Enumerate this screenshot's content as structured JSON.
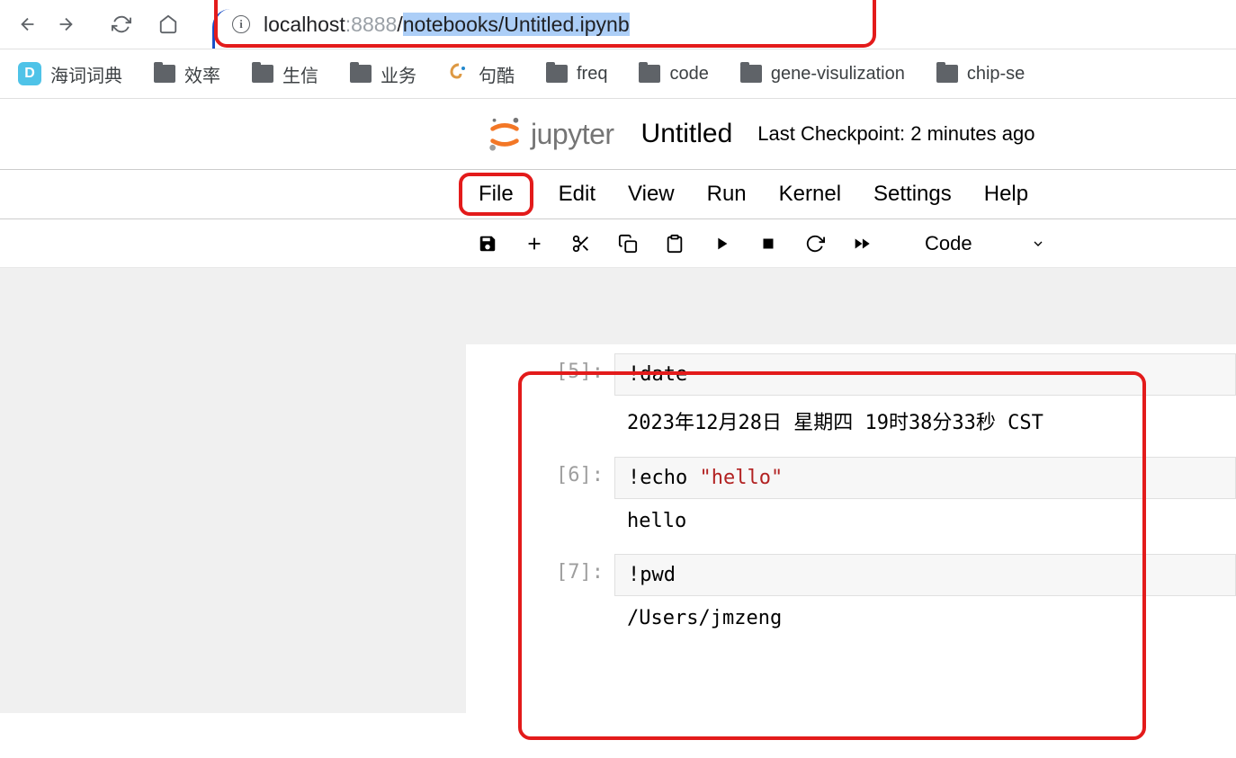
{
  "browser": {
    "url_host": "localhost",
    "url_port": ":8888",
    "url_slash": "/",
    "url_path": "notebooks/Untitled.ipynb"
  },
  "bookmarks": [
    {
      "label": "海词词典",
      "icon": "d"
    },
    {
      "label": "效率",
      "icon": "folder"
    },
    {
      "label": "生信",
      "icon": "folder"
    },
    {
      "label": "业务",
      "icon": "folder"
    },
    {
      "label": "句酷",
      "icon": "swirl"
    },
    {
      "label": "freq",
      "icon": "folder"
    },
    {
      "label": "code",
      "icon": "folder"
    },
    {
      "label": "gene-visulization",
      "icon": "folder"
    },
    {
      "label": "chip-se",
      "icon": "folder"
    }
  ],
  "jupyter": {
    "brand": "jupyter",
    "title": "Untitled",
    "checkpoint": "Last Checkpoint: 2 minutes ago"
  },
  "menu": {
    "file": "File",
    "edit": "Edit",
    "view": "View",
    "run": "Run",
    "kernel": "Kernel",
    "settings": "Settings",
    "help": "Help"
  },
  "toolbar": {
    "cell_type": "Code"
  },
  "cells": [
    {
      "prompt": "[5]:",
      "input_plain": "!date",
      "output": "2023年12月28日 星期四 19时38分33秒 CST"
    },
    {
      "prompt": "[6]:",
      "input_prefix": "!echo ",
      "input_string": "\"hello\"",
      "output": "hello"
    },
    {
      "prompt": "[7]:",
      "input_plain": "!pwd",
      "output": "/Users/jmzeng"
    }
  ]
}
